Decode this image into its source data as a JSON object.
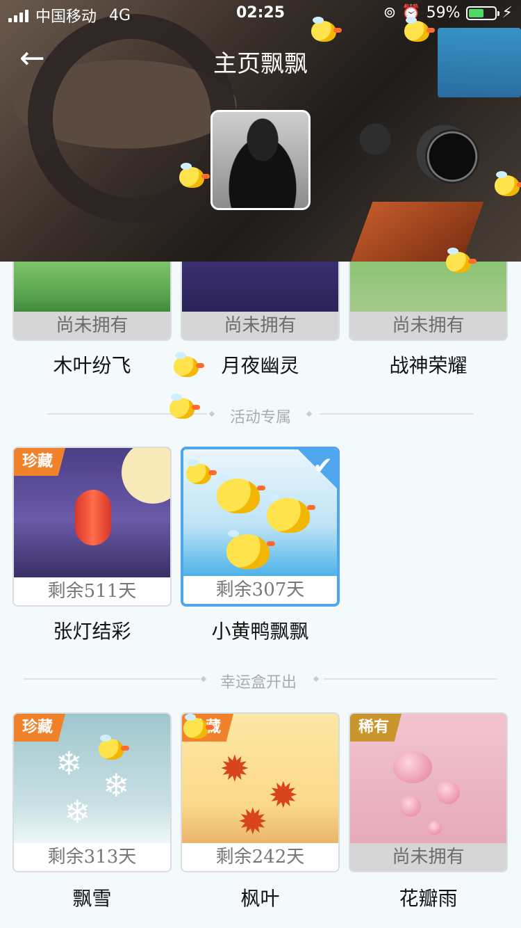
{
  "status_bar": {
    "carrier": "中国移动",
    "network": "4G",
    "time": "02:25",
    "battery": "59%",
    "battery_level": 0.59
  },
  "header": {
    "title": "主页飘飘",
    "back_icon": "arrow-left-icon"
  },
  "top_row": [
    {
      "status": "尚未拥有",
      "name": "木叶纷飞"
    },
    {
      "status": "尚未拥有",
      "name": "月夜幽灵"
    },
    {
      "status": "尚未拥有",
      "name": "战神荣耀"
    }
  ],
  "section_event": {
    "title": "活动专属",
    "items": [
      {
        "badge": "珍藏",
        "status": "剩余511天",
        "name": "张灯结彩"
      },
      {
        "status": "剩余307天",
        "name": "小黄鸭飘飘",
        "selected": true
      }
    ]
  },
  "section_luckybox": {
    "title": "幸运盒开出",
    "items": [
      {
        "badge": "珍藏",
        "status": "剩余313天",
        "name": "飘雪"
      },
      {
        "badge": "珍藏",
        "status": "剩余242天",
        "name": "枫叶"
      },
      {
        "badge": "稀有",
        "status": "尚未拥有",
        "name": "花瓣雨"
      }
    ]
  },
  "colors": {
    "accent": "#4fa6ee",
    "badge_orange": "#f0822b",
    "badge_gold": "#c9952c",
    "battery_green": "#4cd964"
  }
}
